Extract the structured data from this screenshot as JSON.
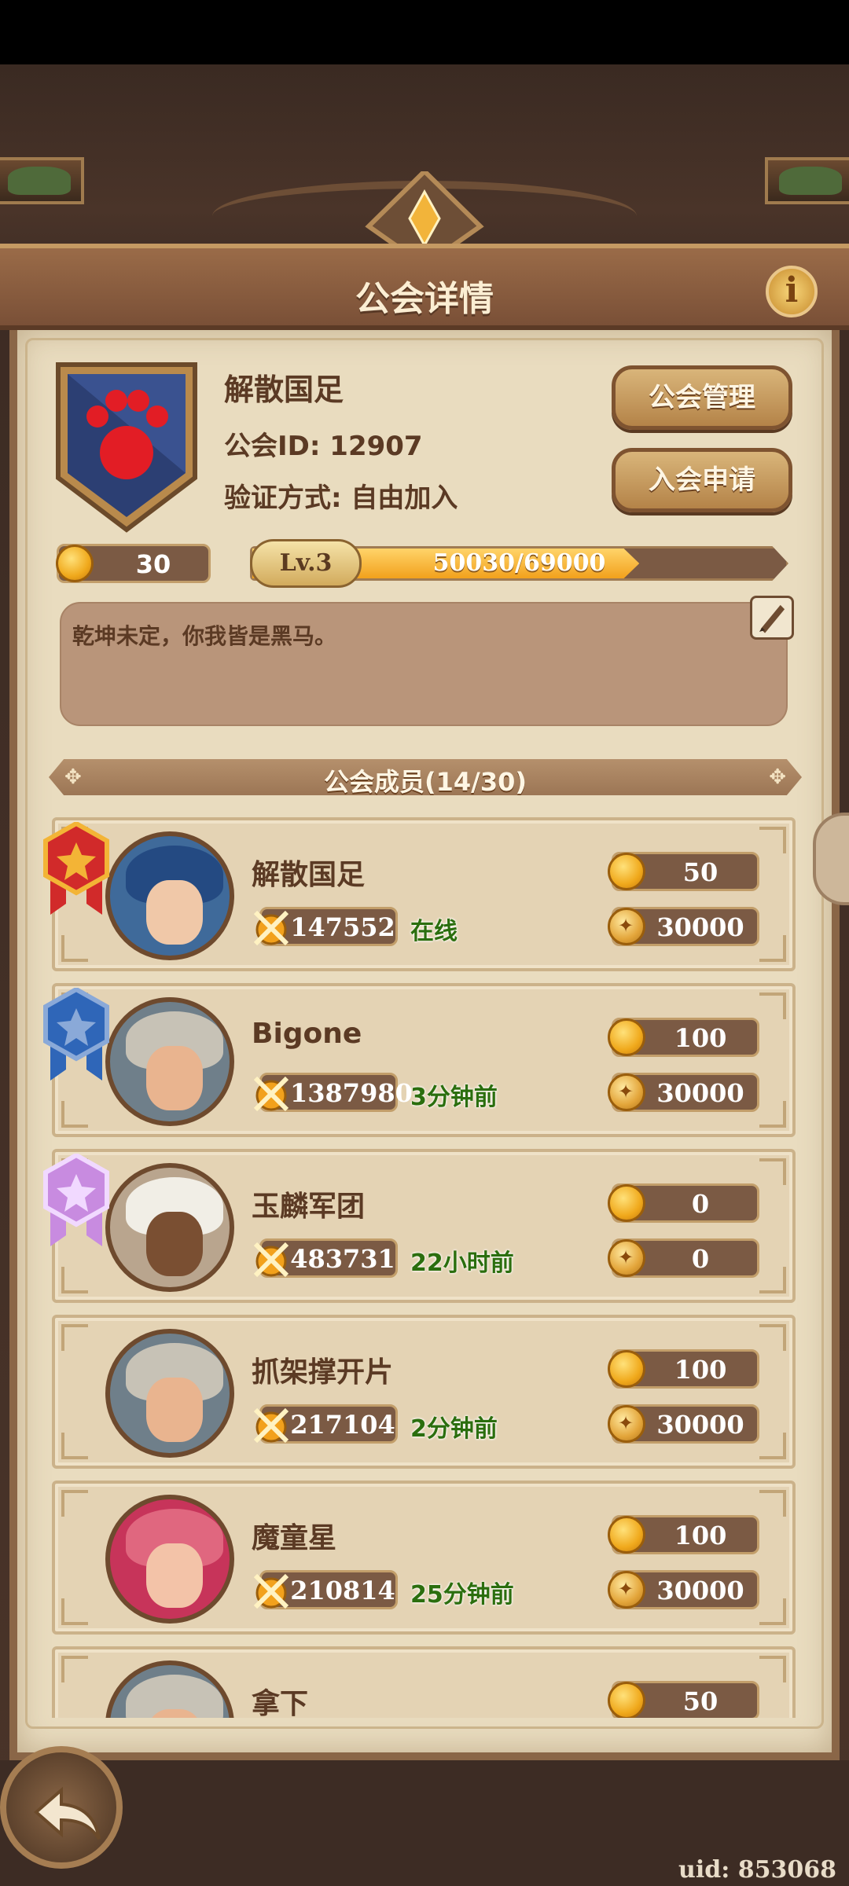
{
  "header": {
    "title": "公会详情",
    "info_icon": "info-icon"
  },
  "guild": {
    "name": "解散国足",
    "id_label": "公会ID: 12907",
    "verify_label": "验证方式: 自由加入",
    "coins": "30",
    "level": "Lv.3",
    "exp_text": "50030/69000",
    "exp_progress": 0.725,
    "motto": "乾坤未定，你我皆是黑马。",
    "emblem": "bear-paw-shield"
  },
  "buttons": {
    "manage": "公会管理",
    "apply": "入会申请"
  },
  "members_title": "公会成员(14/30)",
  "members": [
    {
      "name": "解散国足",
      "power": "147552",
      "status": "在线",
      "contribution": "50",
      "donation": "30000",
      "rank": "leader"
    },
    {
      "name": "Bigone",
      "power": "1387980",
      "status": "3分钟前",
      "contribution": "100",
      "donation": "30000",
      "rank": "vice"
    },
    {
      "name": "玉麟军团",
      "power": "483731",
      "status": "22小时前",
      "contribution": "0",
      "donation": "0",
      "rank": "elite"
    },
    {
      "name": "抓架撑开片",
      "power": "217104",
      "status": "2分钟前",
      "contribution": "100",
      "donation": "30000",
      "rank": ""
    },
    {
      "name": "魔童星",
      "power": "210814",
      "status": "25分钟前",
      "contribution": "100",
      "donation": "30000",
      "rank": ""
    },
    {
      "name": "拿下",
      "power": "",
      "status": "",
      "contribution": "50",
      "donation": "",
      "rank": ""
    }
  ],
  "uid": "uid: 853068",
  "colors": {
    "parchment": "#e9dcbf",
    "frame": "#8a6647",
    "online": "#2b6e0e",
    "accent": "#f2a11c"
  }
}
